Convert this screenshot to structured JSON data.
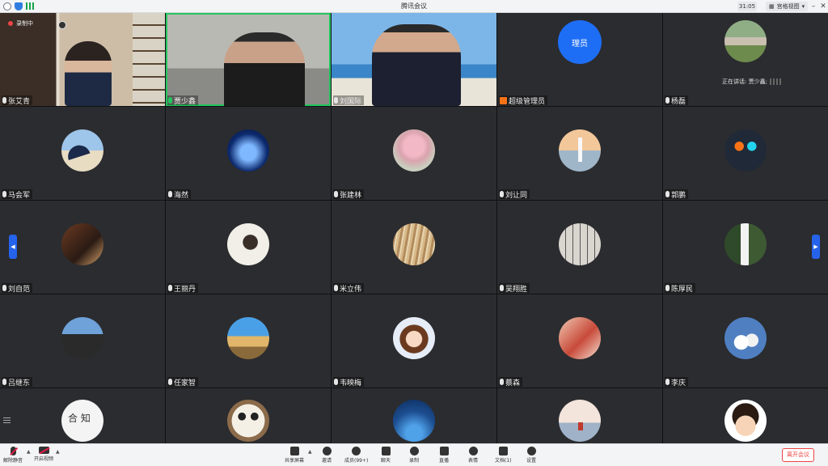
{
  "titlebar": {
    "app_title": "腾讯会议",
    "timer": "31:05",
    "view_mode": "宫格视图",
    "icons": [
      "info-icon",
      "shield-icon",
      "signal-icon"
    ]
  },
  "recording": {
    "label": "录制中"
  },
  "admin_avatar_text": "理员",
  "speaking_text": "正在讲话: 贾少鑫;",
  "participants": [
    {
      "name": "张艾青",
      "type": "video"
    },
    {
      "name": "贾少鑫",
      "type": "video",
      "speaking": true
    },
    {
      "name": "刘国际",
      "type": "video"
    },
    {
      "name": "超级管理员",
      "type": "avatar"
    },
    {
      "name": "杨磊",
      "type": "avatar"
    },
    {
      "name": "马会军",
      "type": "avatar"
    },
    {
      "name": "海然",
      "type": "avatar"
    },
    {
      "name": "张建林",
      "type": "avatar"
    },
    {
      "name": "刘让同",
      "type": "avatar"
    },
    {
      "name": "郭鹏",
      "type": "avatar"
    },
    {
      "name": "刘自范",
      "type": "avatar"
    },
    {
      "name": "王丽丹",
      "type": "avatar"
    },
    {
      "name": "米立伟",
      "type": "avatar"
    },
    {
      "name": "吴翔胜",
      "type": "avatar"
    },
    {
      "name": "陈厚民",
      "type": "avatar"
    },
    {
      "name": "吕继东",
      "type": "avatar"
    },
    {
      "name": "任家智",
      "type": "avatar"
    },
    {
      "name": "韦映梅",
      "type": "avatar"
    },
    {
      "name": "蔡森",
      "type": "avatar"
    },
    {
      "name": "李庆",
      "type": "avatar"
    },
    {
      "name": "",
      "type": "avatar"
    },
    {
      "name": "",
      "type": "avatar"
    },
    {
      "name": "",
      "type": "avatar"
    },
    {
      "name": "",
      "type": "avatar"
    },
    {
      "name": "",
      "type": "avatar"
    }
  ],
  "toolbar": {
    "unmute": "解除静音",
    "start_video": "开启视频",
    "share_screen": "共享屏幕",
    "invite": "邀请",
    "members": "成员(99+)",
    "chat": "聊天",
    "record": "录制",
    "live": "直播",
    "reactions": "表情",
    "docs": "文档(1)",
    "settings": "设置",
    "leave": "离开会议"
  },
  "colors": {
    "accent": "#1e6ef5",
    "leave": "#ef4444",
    "speaking_border": "#22c55e"
  }
}
